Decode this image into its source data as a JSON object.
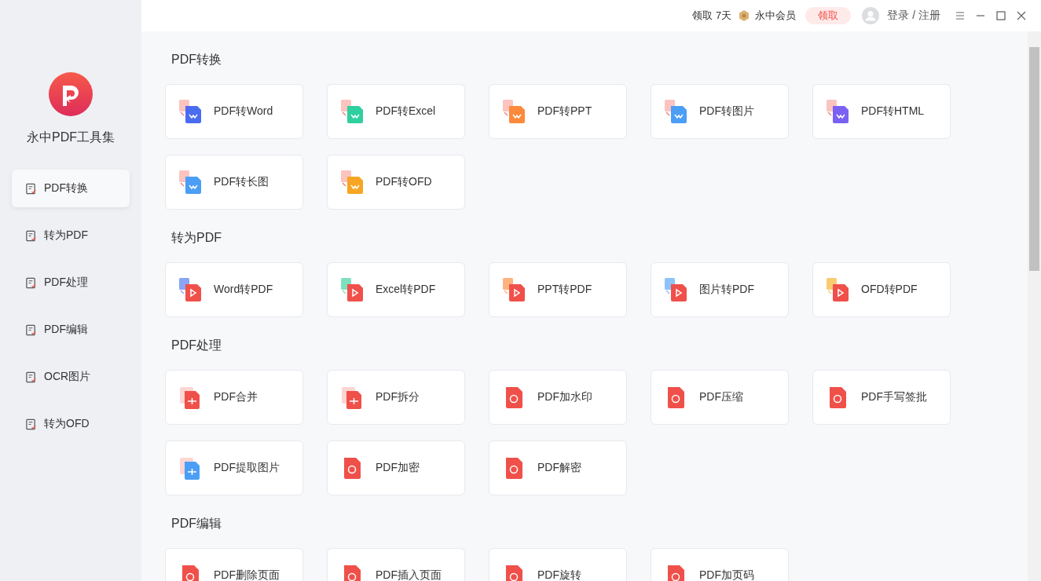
{
  "sidebar": {
    "app_name": "永中PDF工具集",
    "items": [
      {
        "label": "PDF转换",
        "selected": true
      },
      {
        "label": "转为PDF",
        "selected": false
      },
      {
        "label": "PDF处理",
        "selected": false
      },
      {
        "label": "PDF编辑",
        "selected": false
      },
      {
        "label": "OCR图片",
        "selected": false
      },
      {
        "label": "转为OFD",
        "selected": false
      }
    ]
  },
  "topbar": {
    "trial": "领取 7天",
    "membership": "永中会员",
    "claim_button": "领取",
    "login": "登录 / 注册"
  },
  "sections": [
    {
      "title": "PDF转换",
      "tools": [
        {
          "label": "PDF转Word",
          "kind": "convert",
          "color": "#4a6cf0"
        },
        {
          "label": "PDF转Excel",
          "kind": "convert",
          "color": "#2fcf9f"
        },
        {
          "label": "PDF转PPT",
          "kind": "convert",
          "color": "#fb8a3c"
        },
        {
          "label": "PDF转图片",
          "kind": "convert",
          "color": "#4b9ef5"
        },
        {
          "label": "PDF转HTML",
          "kind": "convert",
          "color": "#7b61f3"
        },
        {
          "label": "PDF转长图",
          "kind": "convert",
          "color": "#4b9ef5"
        },
        {
          "label": "PDF转OFD",
          "kind": "convert",
          "color": "#f6a623"
        }
      ]
    },
    {
      "title": "转为PDF",
      "tools": [
        {
          "label": "Word转PDF",
          "kind": "to_pdf",
          "color": "#8aa4f6"
        },
        {
          "label": "Excel转PDF",
          "kind": "to_pdf",
          "color": "#7fe0c0"
        },
        {
          "label": "PPT转PDF",
          "kind": "to_pdf",
          "color": "#fcb37f"
        },
        {
          "label": "图片转PDF",
          "kind": "to_pdf",
          "color": "#8cc3f8"
        },
        {
          "label": "OFD转PDF",
          "kind": "to_pdf",
          "color": "#f8cc72"
        }
      ]
    },
    {
      "title": "PDF处理",
      "tools": [
        {
          "label": "PDF合并",
          "kind": "stack",
          "color": "#f0504a"
        },
        {
          "label": "PDF拆分",
          "kind": "stack",
          "color": "#f0504a"
        },
        {
          "label": "PDF加水印",
          "kind": "single",
          "color": "#f0504a"
        },
        {
          "label": "PDF压缩",
          "kind": "single",
          "color": "#f0504a"
        },
        {
          "label": "PDF手写签批",
          "kind": "single",
          "color": "#f0504a"
        },
        {
          "label": "PDF提取图片",
          "kind": "stack",
          "color": "#4b9ef5"
        },
        {
          "label": "PDF加密",
          "kind": "single",
          "color": "#f0504a"
        },
        {
          "label": "PDF解密",
          "kind": "single",
          "color": "#f0504a"
        }
      ]
    },
    {
      "title": "PDF编辑",
      "tools": [
        {
          "label": "PDF删除页面",
          "kind": "single",
          "color": "#f0504a"
        },
        {
          "label": "PDF插入页面",
          "kind": "single",
          "color": "#f0504a"
        },
        {
          "label": "PDF旋转",
          "kind": "single",
          "color": "#f0504a"
        },
        {
          "label": "PDF加页码",
          "kind": "single",
          "color": "#f0504a"
        }
      ]
    }
  ]
}
